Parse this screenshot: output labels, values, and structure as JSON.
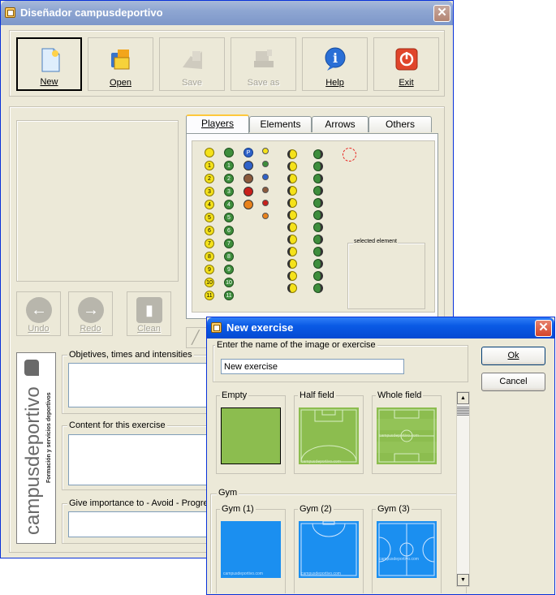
{
  "main_window": {
    "title": "Diseñador campusdeportivo",
    "toolbar": [
      {
        "key": "new",
        "label": "New",
        "icon": "new-document-icon",
        "enabled": true
      },
      {
        "key": "open",
        "label": "Open",
        "icon": "open-folder-icon",
        "enabled": true
      },
      {
        "key": "save",
        "label": "Save",
        "icon": "save-icon",
        "enabled": false
      },
      {
        "key": "save_as",
        "label": "Save as",
        "icon": "save-as-icon",
        "enabled": false
      },
      {
        "key": "help",
        "label": "Help",
        "icon": "help-icon",
        "enabled": true
      },
      {
        "key": "exit",
        "label": "Exit",
        "icon": "power-icon",
        "enabled": true
      }
    ],
    "tabs": [
      "Players",
      "Elements",
      "Arrows",
      "Others"
    ],
    "active_tab": "Players",
    "player_numbers": [
      "1",
      "2",
      "3",
      "4",
      "5",
      "6",
      "7",
      "8",
      "9",
      "10",
      "11"
    ],
    "special_player_label": "P",
    "selected_element_label": "selected element",
    "edit_buttons": {
      "undo": "Undo",
      "redo": "Redo",
      "clean": "Clean"
    },
    "sections": {
      "objectives": "Objetives, times and intensities",
      "content": "Content for this exercise",
      "importance": "Give importance to - Avoid - Progres"
    },
    "logo": {
      "name": "campusdeportivo",
      "tagline": "Formación y servicios deportivos"
    }
  },
  "dialog": {
    "title": "New exercise",
    "name_group_label": "Enter the name of the image or exercise",
    "name_value": "New exercise",
    "ok_label": "Ok",
    "cancel_label": "Cancel",
    "fields": [
      {
        "label": "Empty",
        "style": "empty"
      },
      {
        "label": "Half field",
        "style": "half"
      },
      {
        "label": "Whole field",
        "style": "whole"
      }
    ],
    "gym_group_label": "Gym",
    "gyms": [
      {
        "label": "Gym (1)"
      },
      {
        "label": "Gym (2)"
      },
      {
        "label": "Gym (3)"
      }
    ],
    "watermark": "campusdeportivo.com"
  },
  "colors": {
    "field_green": "#8cbd4f",
    "gym_blue": "#1b8ff0",
    "player_yellow": "#f5e21a",
    "player_green": "#3e8e3c"
  }
}
